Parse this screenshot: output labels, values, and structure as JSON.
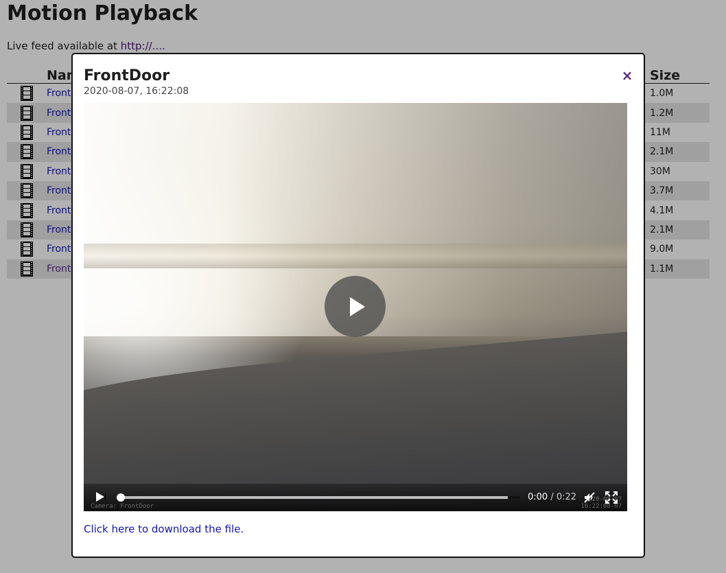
{
  "page": {
    "title": "Motion Playback",
    "live_prefix": "Live feed available at ",
    "live_link": "http://...."
  },
  "table": {
    "headers": {
      "icon": "",
      "name": "Name",
      "size": "Size"
    },
    "rows": [
      {
        "name": "Front",
        "size": "1.0M",
        "visited": false
      },
      {
        "name": "Front",
        "size": "1.2M",
        "visited": false
      },
      {
        "name": "Front",
        "size": "11M",
        "visited": false
      },
      {
        "name": "Front",
        "size": "2.1M",
        "visited": false
      },
      {
        "name": "Front",
        "size": "30M",
        "visited": false
      },
      {
        "name": "Front",
        "size": "3.7M",
        "visited": false
      },
      {
        "name": "Front",
        "size": "4.1M",
        "visited": false
      },
      {
        "name": "Front",
        "size": "2.1M",
        "visited": false
      },
      {
        "name": "Front",
        "size": "9.0M",
        "visited": false
      },
      {
        "name": "Front",
        "size": "1.1M",
        "visited": true
      }
    ]
  },
  "modal": {
    "title": "FrontDoor",
    "subtitle": "2020-08-07, 16:22:08",
    "close_label": "×",
    "download_label": "Click here to download the file.",
    "video": {
      "current_time": "0:00",
      "separator": " / ",
      "duration": "0:22",
      "progress": 0.0,
      "muted": true,
      "overlay_camera": "Camera: FrontDoor",
      "overlay_date": "2020-08-07",
      "overlay_time": "16:22:08-07"
    }
  },
  "icons": {
    "file_row": "film-icon",
    "close": "close-icon",
    "play": "play-icon",
    "mute": "muted-speaker-icon",
    "fullscreen": "fullscreen-icon"
  },
  "colors": {
    "link": "#1515b5",
    "visited_link": "#5a2b8a",
    "close": "#5a2b8a",
    "row_stripe": "#e6e6e6"
  }
}
